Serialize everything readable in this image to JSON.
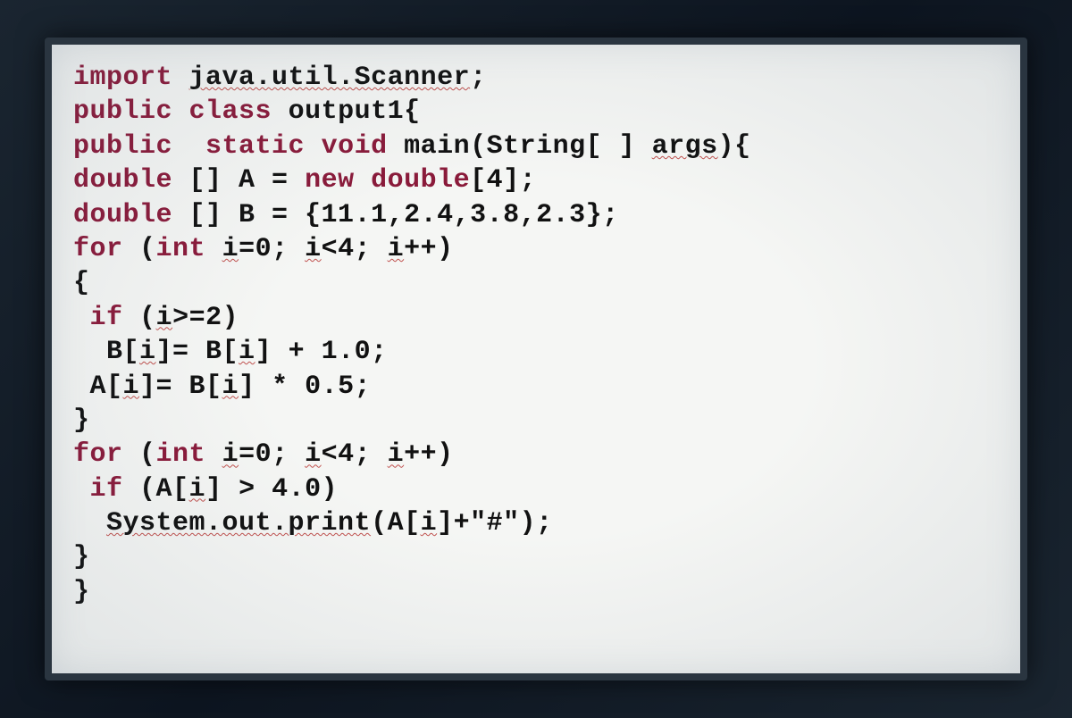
{
  "code": {
    "lines": [
      {
        "segments": [
          {
            "t": "import",
            "cls": "kw"
          },
          {
            "t": " "
          },
          {
            "t": "java.util.Scanner",
            "cls": "wavy"
          },
          {
            "t": ";"
          }
        ]
      },
      {
        "segments": [
          {
            "t": "public",
            "cls": "kw"
          },
          {
            "t": " "
          },
          {
            "t": "class",
            "cls": "kw"
          },
          {
            "t": " output1{"
          }
        ]
      },
      {
        "segments": [
          {
            "t": "public",
            "cls": "kw"
          },
          {
            "t": "  "
          },
          {
            "t": "static",
            "cls": "kw"
          },
          {
            "t": " "
          },
          {
            "t": "void",
            "cls": "kw"
          },
          {
            "t": " main(String[ ] "
          },
          {
            "t": "args",
            "cls": "wavy"
          },
          {
            "t": "){"
          }
        ]
      },
      {
        "segments": [
          {
            "t": "double",
            "cls": "kw"
          },
          {
            "t": " [] A = "
          },
          {
            "t": "new",
            "cls": "kw"
          },
          {
            "t": " "
          },
          {
            "t": "double",
            "cls": "kw"
          },
          {
            "t": "[4];"
          }
        ]
      },
      {
        "segments": [
          {
            "t": "double",
            "cls": "kw"
          },
          {
            "t": " [] B = {11.1,2.4,3.8,2.3};"
          }
        ]
      },
      {
        "segments": [
          {
            "t": "for",
            "cls": "kw"
          },
          {
            "t": " ("
          },
          {
            "t": "int",
            "cls": "kw"
          },
          {
            "t": " "
          },
          {
            "t": "i",
            "cls": "wavy"
          },
          {
            "t": "=0; "
          },
          {
            "t": "i",
            "cls": "wavy"
          },
          {
            "t": "<4; "
          },
          {
            "t": "i",
            "cls": "wavy"
          },
          {
            "t": "++)"
          }
        ]
      },
      {
        "segments": [
          {
            "t": "{"
          }
        ]
      },
      {
        "segments": [
          {
            "t": " "
          },
          {
            "t": "if",
            "cls": "kw"
          },
          {
            "t": " ("
          },
          {
            "t": "i",
            "cls": "wavy"
          },
          {
            "t": ">=2)"
          }
        ]
      },
      {
        "segments": [
          {
            "t": "  B["
          },
          {
            "t": "i",
            "cls": "wavy"
          },
          {
            "t": "]= B["
          },
          {
            "t": "i",
            "cls": "wavy"
          },
          {
            "t": "] + 1.0;"
          }
        ]
      },
      {
        "segments": [
          {
            "t": " A["
          },
          {
            "t": "i",
            "cls": "wavy"
          },
          {
            "t": "]= B["
          },
          {
            "t": "i",
            "cls": "wavy"
          },
          {
            "t": "] * 0.5;"
          }
        ]
      },
      {
        "segments": [
          {
            "t": "}"
          }
        ]
      },
      {
        "segments": [
          {
            "t": ""
          }
        ]
      },
      {
        "segments": [
          {
            "t": "for",
            "cls": "kw"
          },
          {
            "t": " ("
          },
          {
            "t": "int",
            "cls": "kw"
          },
          {
            "t": " "
          },
          {
            "t": "i",
            "cls": "wavy"
          },
          {
            "t": "=0; "
          },
          {
            "t": "i",
            "cls": "wavy"
          },
          {
            "t": "<4; "
          },
          {
            "t": "i",
            "cls": "wavy"
          },
          {
            "t": "++)"
          }
        ]
      },
      {
        "segments": [
          {
            "t": " "
          },
          {
            "t": "if",
            "cls": "kw"
          },
          {
            "t": " (A["
          },
          {
            "t": "i",
            "cls": "wavy"
          },
          {
            "t": "] > 4.0)"
          }
        ]
      },
      {
        "segments": [
          {
            "t": "  "
          },
          {
            "t": "System.out.print",
            "cls": "wavy"
          },
          {
            "t": "(A["
          },
          {
            "t": "i",
            "cls": "wavy"
          },
          {
            "t": "]+\"#\");"
          }
        ]
      },
      {
        "segments": [
          {
            "t": "}"
          }
        ]
      },
      {
        "segments": [
          {
            "t": "}"
          }
        ]
      }
    ]
  }
}
